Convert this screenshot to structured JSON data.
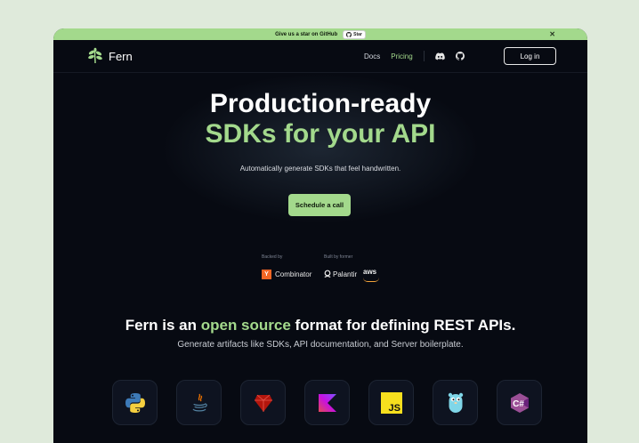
{
  "banner": {
    "text": "Give us a star on GitHub",
    "star_label": "Star",
    "close": "✕"
  },
  "nav": {
    "brand": "Fern",
    "links": [
      {
        "label": "Docs"
      },
      {
        "label": "Pricing"
      }
    ],
    "login": "Log in"
  },
  "hero": {
    "title_line1": "Production-ready",
    "title_line2": "SDKs for your API",
    "subtitle": "Automatically generate SDKs that feel handwritten.",
    "cta": "Schedule a call"
  },
  "backing": {
    "backed_by": "Backed by",
    "built_by": "Built by former",
    "yc_letter": "Y",
    "yc_name": "Combinator",
    "palantir": "Palantir",
    "aws": "aws"
  },
  "open_source": {
    "prefix": "Fern is an ",
    "highlight": "open source",
    "suffix": " format for defining REST APIs.",
    "subtitle": "Generate artifacts like SDKs, API documentation, and Server boilerplate."
  },
  "languages": [
    {
      "icon": "python-icon"
    },
    {
      "icon": "java-icon"
    },
    {
      "icon": "ruby-icon"
    },
    {
      "icon": "kotlin-icon"
    },
    {
      "icon": "javascript-icon",
      "label": "JS"
    },
    {
      "icon": "go-icon"
    },
    {
      "icon": "csharp-icon",
      "label": "C#"
    }
  ],
  "colors": {
    "accent": "#a3d98c",
    "background": "#070a12",
    "page": "#dfeadb"
  }
}
